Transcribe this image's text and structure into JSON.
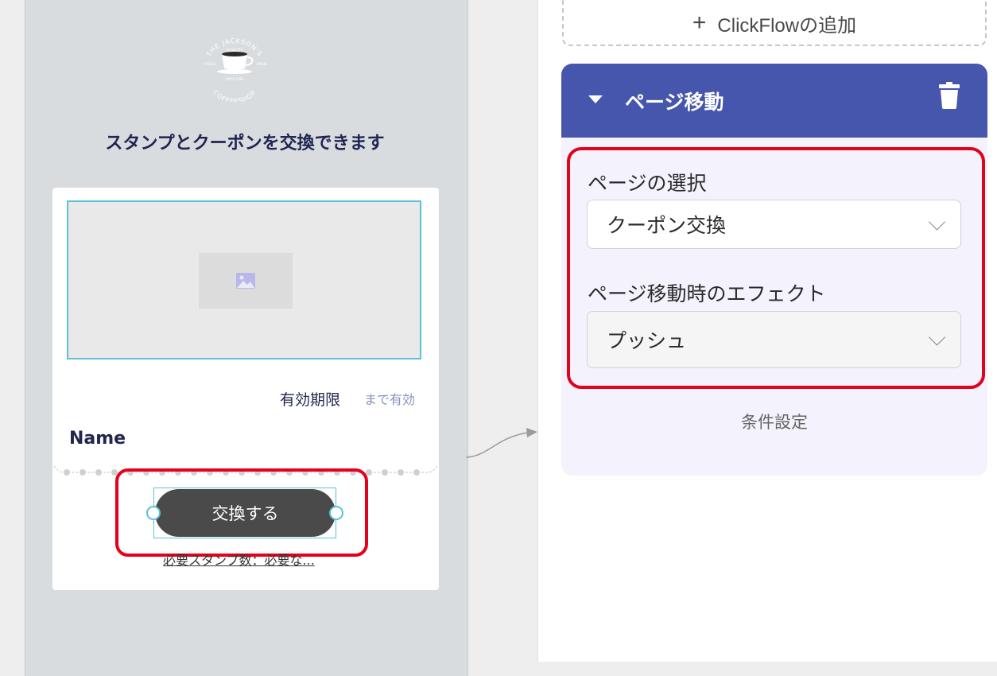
{
  "preview": {
    "logo": {
      "top_text": "THE JACKSON'S",
      "quality": "QUALITY",
      "left_text": "FRESH",
      "right_text": "MADE",
      "since": "SINCE 1983",
      "bottom_text": "COFFEESHOP"
    },
    "heading": "スタンプとクーポンを交換できます",
    "expiry_label": "有効期限",
    "expiry_suffix": "まで有効",
    "name_label": "Name",
    "exchange_button": "交換する",
    "required_stamps": "必要スタンプ数：必要な..."
  },
  "editor": {
    "add_clickflow": "ClickFlowの追加",
    "panel_title": "ページ移動",
    "page_select_label": "ページの選択",
    "page_select_value": "クーポン交換",
    "effect_label": "ページ移動時のエフェクト",
    "effect_value": "プッシュ",
    "condition_label": "条件設定"
  },
  "colors": {
    "accent": "#4656ac",
    "highlight": "#e5001c",
    "selection": "#5ac3d5"
  },
  "icons": [
    "coffee-logo",
    "image-placeholder-icon",
    "plus-icon",
    "caret-down-icon",
    "trash-icon",
    "chevron-down-icon",
    "flow-arrow-icon"
  ]
}
